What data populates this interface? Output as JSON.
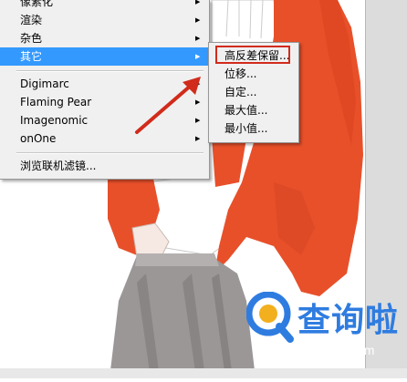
{
  "menu": {
    "items": [
      {
        "label": "像素化",
        "submenu": true
      },
      {
        "label": "渲染",
        "submenu": true
      },
      {
        "label": "杂色",
        "submenu": true
      },
      {
        "label": "其它",
        "submenu": true,
        "active": true
      },
      {
        "label": "Digimarc",
        "submenu": true
      },
      {
        "label": "Flaming Pear",
        "submenu": true
      },
      {
        "label": "Imagenomic",
        "submenu": true
      },
      {
        "label": "onOne",
        "submenu": true
      },
      {
        "label": "浏览联机滤镜...",
        "submenu": false
      }
    ]
  },
  "submenu": {
    "items": [
      {
        "label": "高反差保留..."
      },
      {
        "label": "位移..."
      },
      {
        "label": "自定..."
      },
      {
        "label": "最大值..."
      },
      {
        "label": "最小值..."
      }
    ]
  },
  "watermark": {
    "text": "查询啦",
    "url": "chaxunla.com"
  },
  "colors": {
    "menu_bg": "#f0f0f0",
    "active": "#3399ff",
    "annotation": "#d12b1b",
    "jacket": "#e8502a",
    "pants": "#9b9797",
    "brand": "#2f7ce0"
  },
  "icons": [
    "submenu-arrow-icon",
    "red-annotation-arrow",
    "chaxunla-logo-icon"
  ]
}
